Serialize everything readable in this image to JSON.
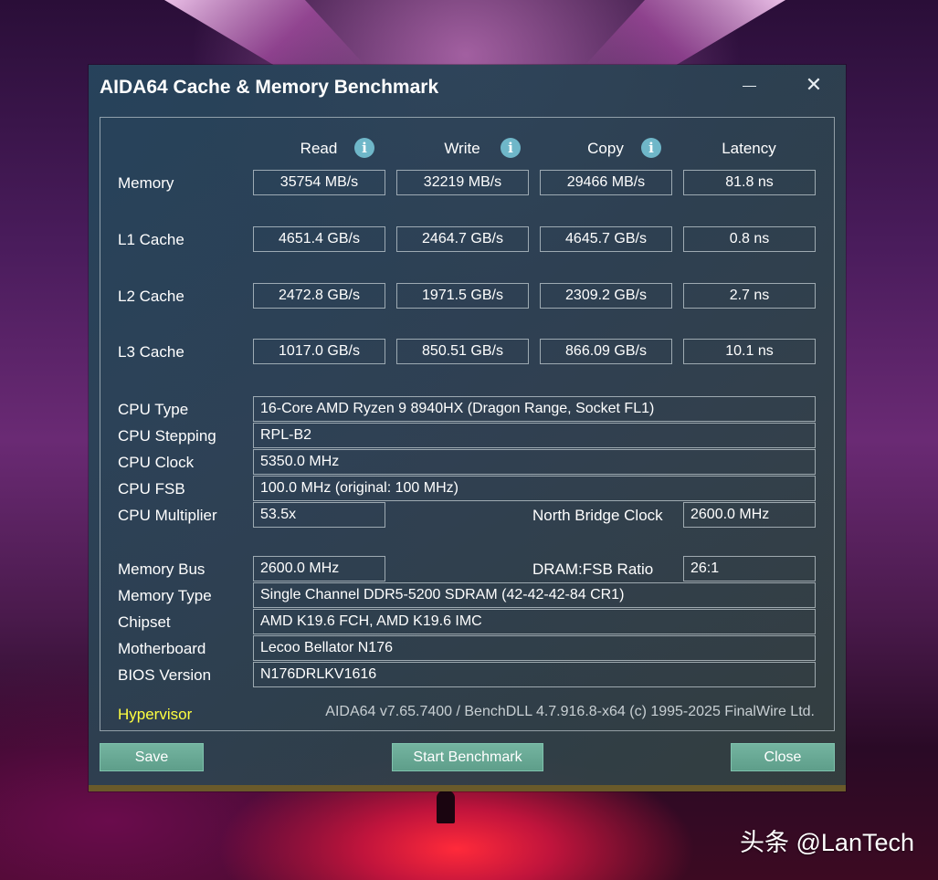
{
  "window": {
    "title": "AIDA64 Cache & Memory Benchmark",
    "close_glyph": "✕"
  },
  "columns": {
    "read": "Read",
    "write": "Write",
    "copy": "Copy",
    "latency": "Latency",
    "info_glyph": "i"
  },
  "rows": [
    {
      "label": "Memory",
      "read": "35754 MB/s",
      "write": "32219 MB/s",
      "copy": "29466 MB/s",
      "latency": "81.8 ns"
    },
    {
      "label": "L1 Cache",
      "read": "4651.4 GB/s",
      "write": "2464.7 GB/s",
      "copy": "4645.7 GB/s",
      "latency": "0.8 ns"
    },
    {
      "label": "L2 Cache",
      "read": "2472.8 GB/s",
      "write": "1971.5 GB/s",
      "copy": "2309.2 GB/s",
      "latency": "2.7 ns"
    },
    {
      "label": "L3 Cache",
      "read": "1017.0 GB/s",
      "write": "850.51 GB/s",
      "copy": "866.09 GB/s",
      "latency": "10.1 ns"
    }
  ],
  "cpu": {
    "type_label": "CPU Type",
    "type": "16-Core AMD Ryzen 9 8940HX  (Dragon Range, Socket FL1)",
    "stepping_label": "CPU Stepping",
    "stepping": "RPL-B2",
    "clock_label": "CPU Clock",
    "clock": "5350.0 MHz",
    "fsb_label": "CPU FSB",
    "fsb": "100.0 MHz  (original: 100 MHz)",
    "multiplier_label": "CPU Multiplier",
    "multiplier": "53.5x",
    "nb_clock_label": "North Bridge Clock",
    "nb_clock": "2600.0 MHz"
  },
  "memory": {
    "bus_label": "Memory Bus",
    "bus": "2600.0 MHz",
    "ratio_label": "DRAM:FSB Ratio",
    "ratio": "26:1",
    "type_label": "Memory Type",
    "type": "Single Channel DDR5-5200 SDRAM  (42-42-42-84 CR1)",
    "chipset_label": "Chipset",
    "chipset": "AMD K19.6 FCH, AMD K19.6 IMC",
    "motherboard_label": "Motherboard",
    "motherboard": "Lecoo Bellator N176",
    "bios_label": "BIOS Version",
    "bios": "N176DRLKV1616"
  },
  "footer": {
    "hypervisor": "Hypervisor",
    "version": "AIDA64 v7.65.7400 / BenchDLL 4.7.916.8-x64  (c) 1995-2025 FinalWire Ltd."
  },
  "buttons": {
    "save": "Save",
    "start": "Start Benchmark",
    "close": "Close"
  },
  "watermark": "头条 @LanTech"
}
